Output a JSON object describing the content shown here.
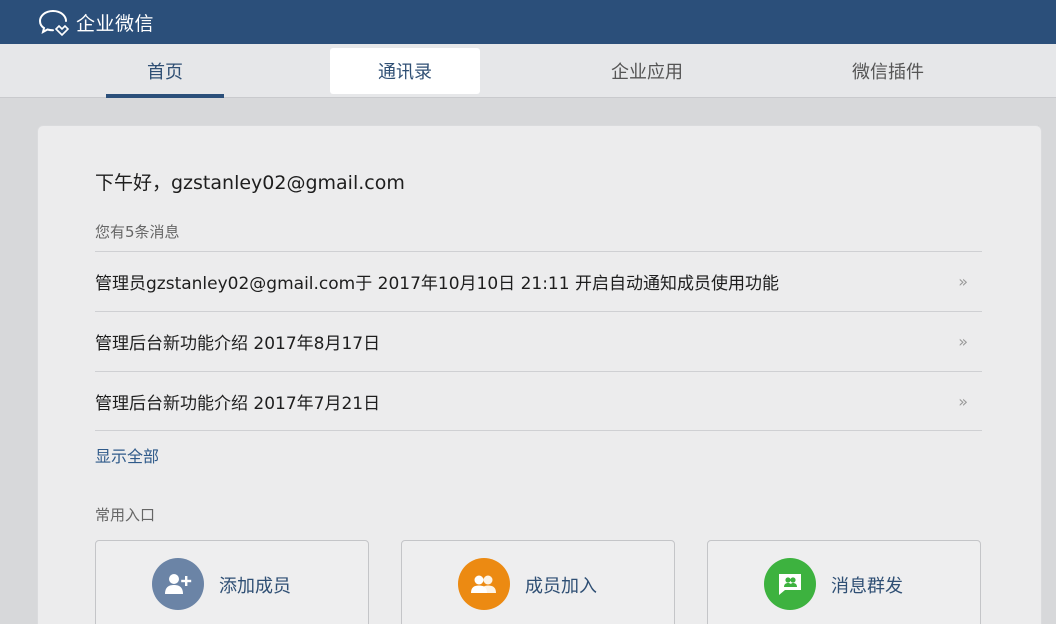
{
  "app": {
    "title": "企业微信"
  },
  "nav": {
    "tabs": [
      {
        "label": "首页"
      },
      {
        "label": "通讯录"
      },
      {
        "label": "企业应用"
      },
      {
        "label": "微信插件"
      }
    ]
  },
  "main": {
    "greeting": "下午好，gzstanley02@gmail.com",
    "message_count": "您有5条消息",
    "messages": [
      {
        "text": "管理员gzstanley02@gmail.com于 2017年10月10日 21:11 开启自动通知成员使用功能",
        "arrow": "»"
      },
      {
        "text": "管理后台新功能介绍 2017年8月17日",
        "arrow": "»"
      },
      {
        "text": "管理后台新功能介绍 2017年7月21日",
        "arrow": "»"
      }
    ],
    "show_all": "显示全部",
    "quick_title": "常用入口",
    "quick_entries": [
      {
        "label": "添加成员",
        "icon": "add-member-icon",
        "color": "#6b84a6"
      },
      {
        "label": "成员加入",
        "icon": "member-join-icon",
        "color": "#ec8a12"
      },
      {
        "label": "消息群发",
        "icon": "broadcast-message-icon",
        "color": "#3db23f"
      }
    ]
  },
  "colors": {
    "topbar": "#2b4f7a",
    "accent": "#2b4f7a"
  }
}
